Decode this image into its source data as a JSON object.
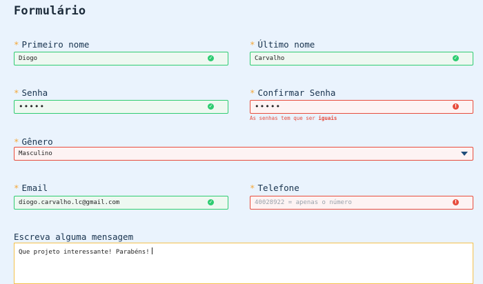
{
  "form": {
    "title": "Formulário",
    "first_name": {
      "label": "Primeiro nome",
      "value": "Diogo",
      "status": "valid"
    },
    "last_name": {
      "label": "Último nome",
      "value": "Carvalho",
      "status": "valid"
    },
    "password": {
      "label": "Senha",
      "value": "•••••",
      "status": "valid"
    },
    "confirm_password": {
      "label": "Confirmar Senha",
      "value": "•••••",
      "status": "invalid",
      "error_prefix": "As senhas tem que ser",
      "error_emphasis": "iguais"
    },
    "gender": {
      "label": "Gênero",
      "selected": "Masculino",
      "status": "invalid"
    },
    "email": {
      "label": "Email",
      "value": "diogo.carvalho.lc@gmail.com",
      "status": "valid"
    },
    "phone": {
      "label": "Telefone",
      "value": "",
      "placeholder": "40028922 = apenas o número",
      "status": "invalid"
    },
    "message": {
      "label": "Escreva alguma mensagem",
      "value": "Que projeto interessante! Parabéns!"
    },
    "required_marker": "*"
  },
  "colors": {
    "background": "#eaf3fd",
    "valid": "#2ecc71",
    "invalid": "#e74c3c",
    "required_star": "#f4a83a",
    "focus": "#f4c04a"
  },
  "icons": {
    "valid": "check-circle-icon",
    "invalid": "exclamation-circle-icon",
    "dropdown": "caret-down-icon"
  }
}
